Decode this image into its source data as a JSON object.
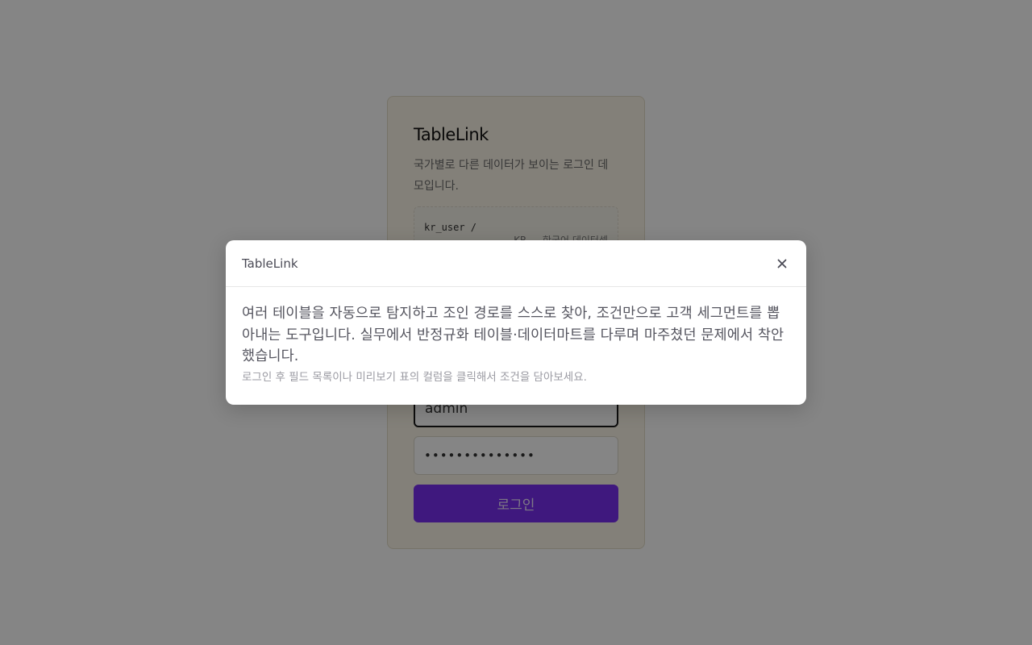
{
  "login": {
    "app_title": "TableLink",
    "subtitle": "국가별로 다른 데이터가 보이는 로그인 데모입니다.",
    "account_id": "kr_user /",
    "account_desc": "KR — 한국어 데이터셋",
    "username_value": "admin",
    "password_value": "••••••••••••••",
    "login_button_label": "로그인",
    "accent_color": "#7a2ff2"
  },
  "modal": {
    "title": "TableLink",
    "close_icon": "close-icon",
    "description": "여러 테이블을 자동으로 탐지하고 조인 경로를 스스로 찾아, 조건만으로 고객 세그먼트를 뽑아내는 도구입니다. 실무에서 반정규화 테이블·데이터마트를 다루며 마주쳤던 문제에서 착안했습니다.",
    "hint": "로그인 후 필드 목록이나 미리보기 표의 컬럼을 클릭해서 조건을 담아보세요."
  }
}
